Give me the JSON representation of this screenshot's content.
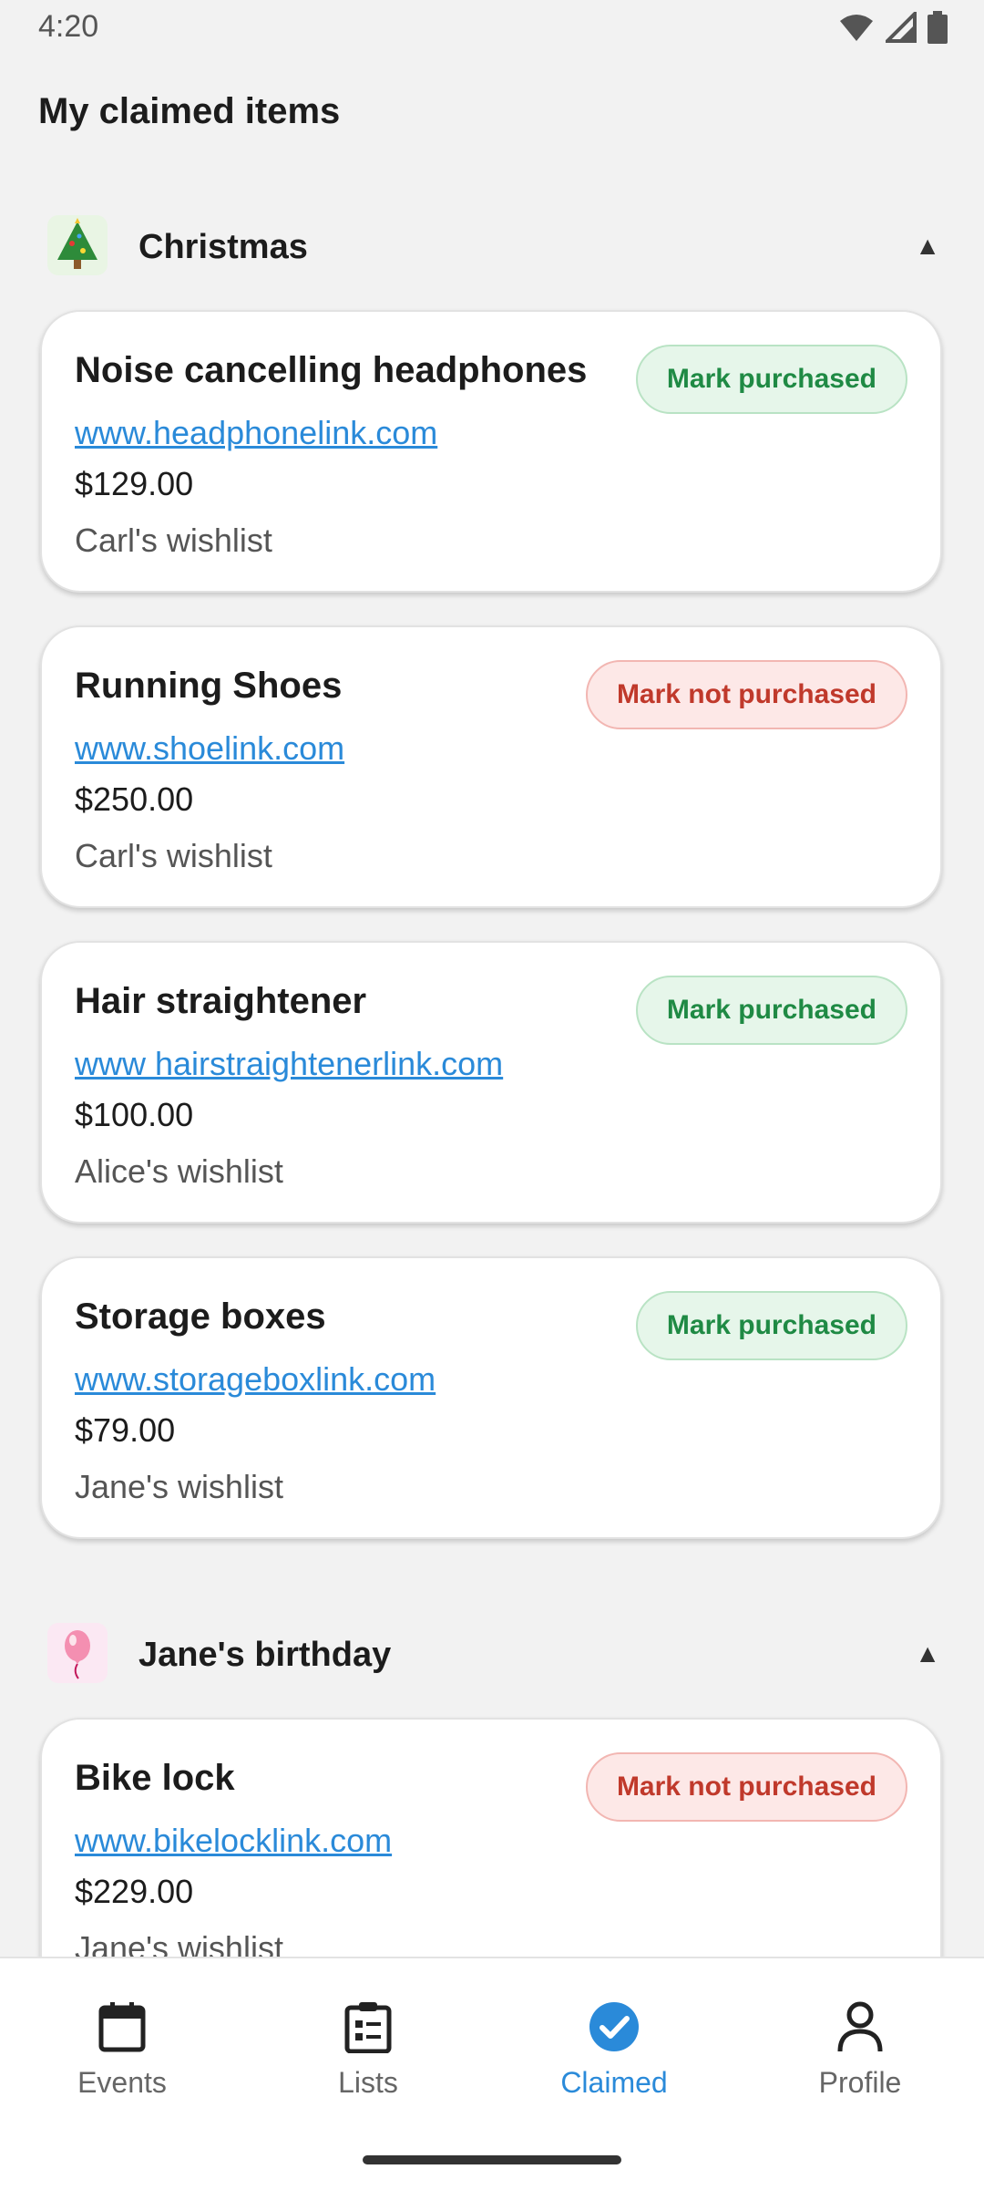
{
  "status_bar": {
    "time": "4:20",
    "icons": [
      "wifi-icon",
      "signal-icon",
      "battery-icon"
    ]
  },
  "header": {
    "title": "My claimed items"
  },
  "sections": [
    {
      "title": "Christmas",
      "emoji": "🎄",
      "toggle": "▲",
      "items": [
        {
          "title": "Noise cancelling headphones",
          "link": "www.headphonelink.com",
          "price": "$129.00",
          "owner": "Carl's wishlist",
          "action": "Mark purchased",
          "action_type": "green"
        },
        {
          "title": "Running Shoes",
          "link": "www.shoelink.com",
          "price": "$250.00",
          "owner": "Carl's wishlist",
          "action": "Mark not purchased",
          "action_type": "red"
        },
        {
          "title": "Hair straightener",
          "link": "www hairstraightenerlink.com",
          "price": "$100.00",
          "owner": "Alice's wishlist",
          "action": "Mark purchased",
          "action_type": "green"
        },
        {
          "title": "Storage boxes",
          "link": "www.storageboxlink.com",
          "price": "$79.00",
          "owner": "Jane's wishlist",
          "action": "Mark purchased",
          "action_type": "green"
        }
      ]
    },
    {
      "title": "Jane's birthday",
      "emoji": "🎈",
      "toggle": "▲",
      "items": [
        {
          "title": "Bike lock",
          "link": "www.bikelocklink.com",
          "price": "$229.00",
          "owner": "Jane's wishlist",
          "action": "Mark not purchased",
          "action_type": "red"
        }
      ]
    }
  ],
  "bottom_nav": {
    "items": [
      {
        "label": "Events",
        "icon": "calendar-icon"
      },
      {
        "label": "Lists",
        "icon": "clipboard-list-icon"
      },
      {
        "label": "Claimed",
        "icon": "check-circle-icon",
        "active": true
      },
      {
        "label": "Profile",
        "icon": "person-icon"
      }
    ]
  },
  "colors": {
    "accent": "#2a8ad9",
    "green": "#1f8a44",
    "red": "#c0392b",
    "background": "#f2f2f2"
  }
}
